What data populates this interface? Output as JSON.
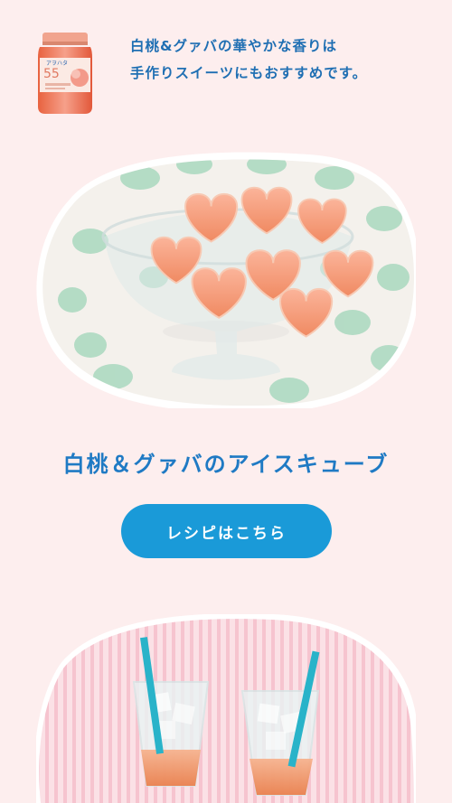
{
  "intro": {
    "line1": "白桃&グァバの華やかな香りは",
    "line2": "手作りスイーツにもおすすめです。"
  },
  "product": {
    "jar_label_number": "55",
    "jar_label_brand": "アヲハタ"
  },
  "recipe": {
    "title": "白桃＆グァバのアイスキューブ",
    "button_label": "レシピはこちら"
  },
  "colors": {
    "background": "#fdeeee",
    "text_blue": "#1f6fb3",
    "button_blue": "#1a9ad8",
    "title_blue": "#1f7ac4"
  }
}
